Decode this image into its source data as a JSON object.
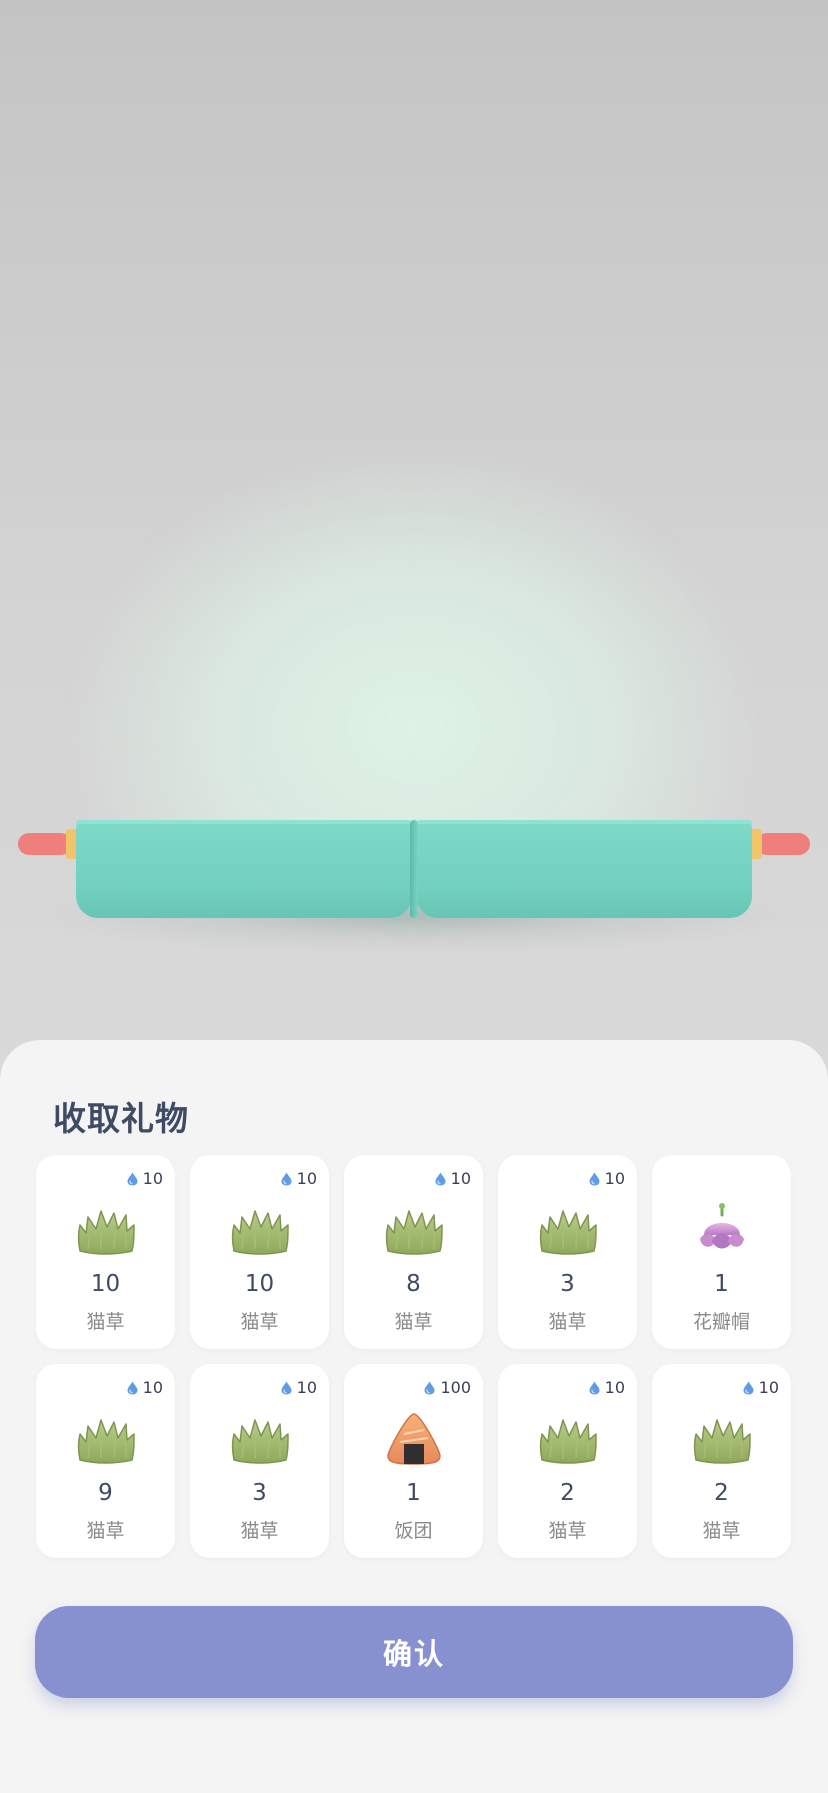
{
  "sheet": {
    "title": "收取礼物",
    "confirm_label": "确认"
  },
  "items": [
    {
      "cost": "10",
      "count": "10",
      "name": "猫草",
      "icon": "cat-grass-icon"
    },
    {
      "cost": "10",
      "count": "10",
      "name": "猫草",
      "icon": "cat-grass-icon"
    },
    {
      "cost": "10",
      "count": "8",
      "name": "猫草",
      "icon": "cat-grass-icon"
    },
    {
      "cost": "10",
      "count": "3",
      "name": "猫草",
      "icon": "cat-grass-icon"
    },
    {
      "cost": "",
      "count": "1",
      "name": "花瓣帽",
      "icon": "petal-hat-icon"
    },
    {
      "cost": "10",
      "count": "9",
      "name": "猫草",
      "icon": "cat-grass-icon"
    },
    {
      "cost": "10",
      "count": "3",
      "name": "猫草",
      "icon": "cat-grass-icon"
    },
    {
      "cost": "100",
      "count": "1",
      "name": "饭团",
      "icon": "rice-ball-icon"
    },
    {
      "cost": "10",
      "count": "2",
      "name": "猫草",
      "icon": "cat-grass-icon"
    },
    {
      "cost": "10",
      "count": "2",
      "name": "猫草",
      "icon": "cat-grass-icon"
    }
  ],
  "colors": {
    "accent": "#8891cf",
    "title": "#3f4a65",
    "tray": "#72d0bf",
    "rod": "#ef7f7a"
  }
}
